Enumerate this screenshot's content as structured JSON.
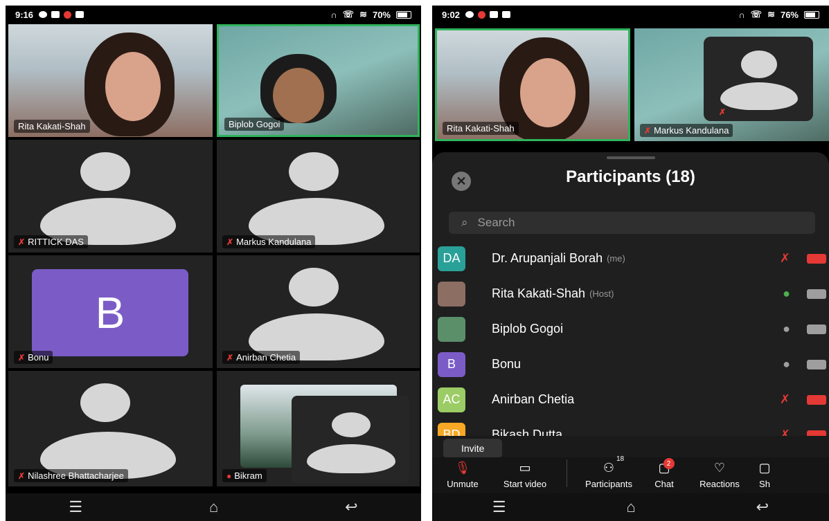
{
  "left": {
    "status": {
      "time": "9:16",
      "battery": "70%"
    },
    "tiles": [
      {
        "name": "Rita Kakati-Shah",
        "muted": false
      },
      {
        "name": "Biplob Gogoi",
        "muted": false
      },
      {
        "name": "RITTICK DAS",
        "muted": true
      },
      {
        "name": "Markus Kandulana",
        "muted": true
      },
      {
        "name": "Bonu",
        "muted": true,
        "initial": "B"
      },
      {
        "name": "Anirban Chetia",
        "muted": true
      },
      {
        "name": "Nilashree Bhattacharjee",
        "muted": true
      },
      {
        "name": "Bikram",
        "muted": false
      }
    ]
  },
  "right": {
    "status": {
      "time": "9:02",
      "battery": "76%"
    },
    "tiles": [
      {
        "name": "Rita Kakati-Shah"
      },
      {
        "name": "Markus Kandulana"
      }
    ],
    "sheet": {
      "title": "Participants (18)",
      "search_placeholder": "Search",
      "participants": [
        {
          "initials": "DA",
          "name": "Dr. Arupanjali Borah",
          "tag": "(me)",
          "color": "#2aa198",
          "mic": "off",
          "cam": "off"
        },
        {
          "initials": "",
          "name": "Rita Kakati-Shah",
          "tag": "(Host)",
          "color": "#8d6e63",
          "mic": "on",
          "cam": "idle"
        },
        {
          "initials": "",
          "name": "Biplob Gogoi",
          "tag": "",
          "color": "#5b8f6a",
          "mic": "idle",
          "cam": "idle"
        },
        {
          "initials": "B",
          "name": "Bonu",
          "tag": "",
          "color": "#7b5cc7",
          "mic": "idle",
          "cam": "idle"
        },
        {
          "initials": "AC",
          "name": "Anirban Chetia",
          "tag": "",
          "color": "#9ccc65",
          "mic": "off",
          "cam": "off"
        },
        {
          "initials": "BD",
          "name": "Bikash Dutta",
          "tag": "",
          "color": "#f9a825",
          "mic": "off",
          "cam": "off"
        }
      ],
      "invite_label": "Invite"
    },
    "toolbar": {
      "unmute": "Unmute",
      "start_video": "Start video",
      "participants": "Participants",
      "participants_count": "18",
      "chat": "Chat",
      "chat_badge": "2",
      "reactions": "Reactions",
      "more": "Sh"
    }
  }
}
